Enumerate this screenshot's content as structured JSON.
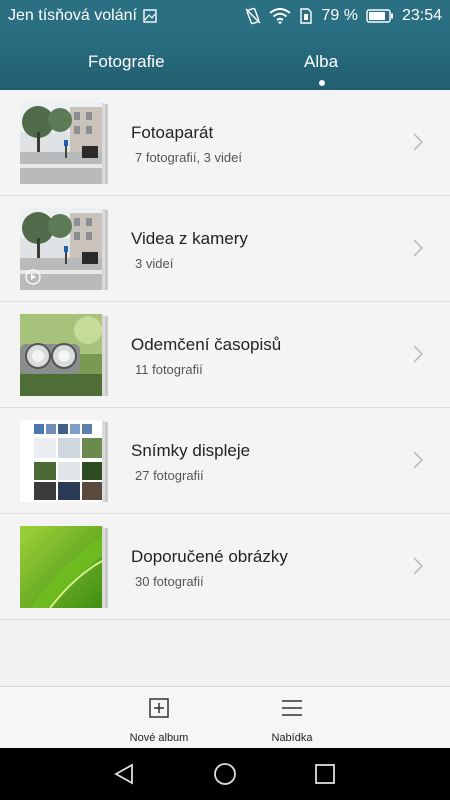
{
  "status_bar": {
    "carrier_text": "Jen tísňová volání",
    "battery_percent": "79 %",
    "time": "23:54",
    "icons": [
      "image-icon",
      "vibrate-icon",
      "wifi-icon",
      "sim-icon",
      "battery-icon"
    ]
  },
  "tabs": [
    {
      "label": "Fotografie",
      "selected": false
    },
    {
      "label": "Alba",
      "selected": true
    }
  ],
  "albums": [
    {
      "title": "Fotoaparát",
      "subtitle": "7 fotografií,  3 videí",
      "thumbnail": "street-photo"
    },
    {
      "title": "Videa z kamery",
      "subtitle": "3 videí",
      "thumbnail": "street-video"
    },
    {
      "title": "Odemčení časopisů",
      "subtitle": "11 fotografií",
      "thumbnail": "headlight-photo"
    },
    {
      "title": "Snímky displeje",
      "subtitle": "27 fotografií",
      "thumbnail": "screenshot-grid"
    },
    {
      "title": "Doporučené obrázky",
      "subtitle": "30 fotografií",
      "thumbnail": "green-leaf"
    }
  ],
  "bottom_bar": {
    "new_album_label": "Nové album",
    "menu_label": "Nabídka"
  },
  "colors": {
    "header": "#2a6f82",
    "background": "#f2f2f2",
    "nav_bar": "#000000"
  }
}
